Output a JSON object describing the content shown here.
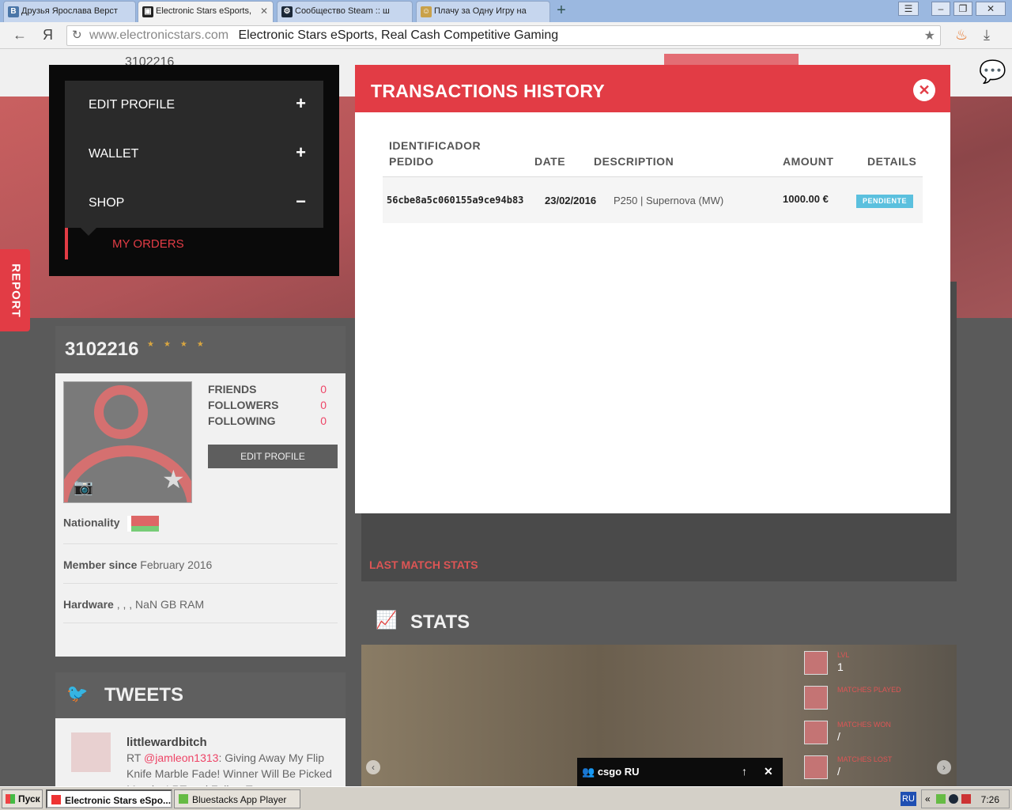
{
  "browser": {
    "tabs": [
      {
        "label": "Друзья Ярослава Верст",
        "favicon": "vk-icon"
      },
      {
        "label": "Electronic Stars eSports,",
        "favicon": "es-icon"
      },
      {
        "label": "Сообщество Steam :: ш",
        "favicon": "steam-icon"
      },
      {
        "label": "Плачу за Одну Игру на",
        "favicon": "game-icon"
      }
    ],
    "new_tab": "+",
    "address": {
      "domain": "www.electronicstars.com",
      "page_title": "Electronic Stars eSports, Real Cash Competitive Gaming"
    },
    "yandex_label": "Я"
  },
  "site": {
    "username_top": "3102216",
    "report_label": "REPORT"
  },
  "menu": {
    "items": [
      {
        "label": "EDIT PROFILE",
        "sign": "+"
      },
      {
        "label": "WALLET",
        "sign": "+"
      },
      {
        "label": "SHOP",
        "sign": "−"
      }
    ],
    "submenu": {
      "label": "MY ORDERS"
    }
  },
  "profile": {
    "name": "3102216",
    "stars": "★★★★",
    "stats": [
      {
        "label": "FRIENDS",
        "value": "0"
      },
      {
        "label": "FOLLOWERS",
        "value": "0"
      },
      {
        "label": "FOLLOWING",
        "value": "0"
      }
    ],
    "edit_button": "EDIT PROFILE",
    "nationality_label": "Nationality",
    "member_since_label": "Member since",
    "member_since_value": "February 2016",
    "hardware_label": "Hardware",
    "hardware_value": ", , , NaN GB RAM"
  },
  "tweets": {
    "title": "TWEETS",
    "user": "littlewardbitch",
    "text_prefix": "RT ",
    "mention": "@jamleon1313",
    "text": ": Giving Away My Flip Knife Marble Fade! Winner Will Be Picked Monday! RT and Follow T..."
  },
  "match": {
    "last_match_label": "LAST MATCH STATS"
  },
  "stats": {
    "title": "STATS",
    "items": [
      {
        "label": "LVL",
        "value": "1"
      },
      {
        "label": "MATCHES PLAYED",
        "value": ""
      },
      {
        "label": "MATCHES WON",
        "value": "/"
      },
      {
        "label": "MATCHES LOST",
        "value": "/"
      }
    ]
  },
  "chat": {
    "label": "csgo RU"
  },
  "modal": {
    "title": "TRANSACTIONS HISTORY",
    "columns": {
      "id_line1": "IDENTIFICADOR",
      "id_line2": "PEDIDO",
      "date": "DATE",
      "description": "DESCRIPTION",
      "amount": "AMOUNT",
      "details": "DETAILS"
    },
    "rows": [
      {
        "id": "56cbe8a5c060155a9ce94b83",
        "date": "23/02/2016",
        "description": "P250 | Supernova (MW)",
        "amount": "1000.00 €",
        "status": "PENDIENTE"
      }
    ]
  },
  "taskbar": {
    "start": "Пуск",
    "tasks": [
      {
        "label": "Electronic Stars eSpo...",
        "active": true
      },
      {
        "label": "Bluestacks App Player",
        "active": false
      }
    ],
    "language": "RU",
    "clock": "7:26"
  },
  "colors": {
    "brand_red": "#e23c45",
    "badge_blue": "#5bc0de"
  }
}
